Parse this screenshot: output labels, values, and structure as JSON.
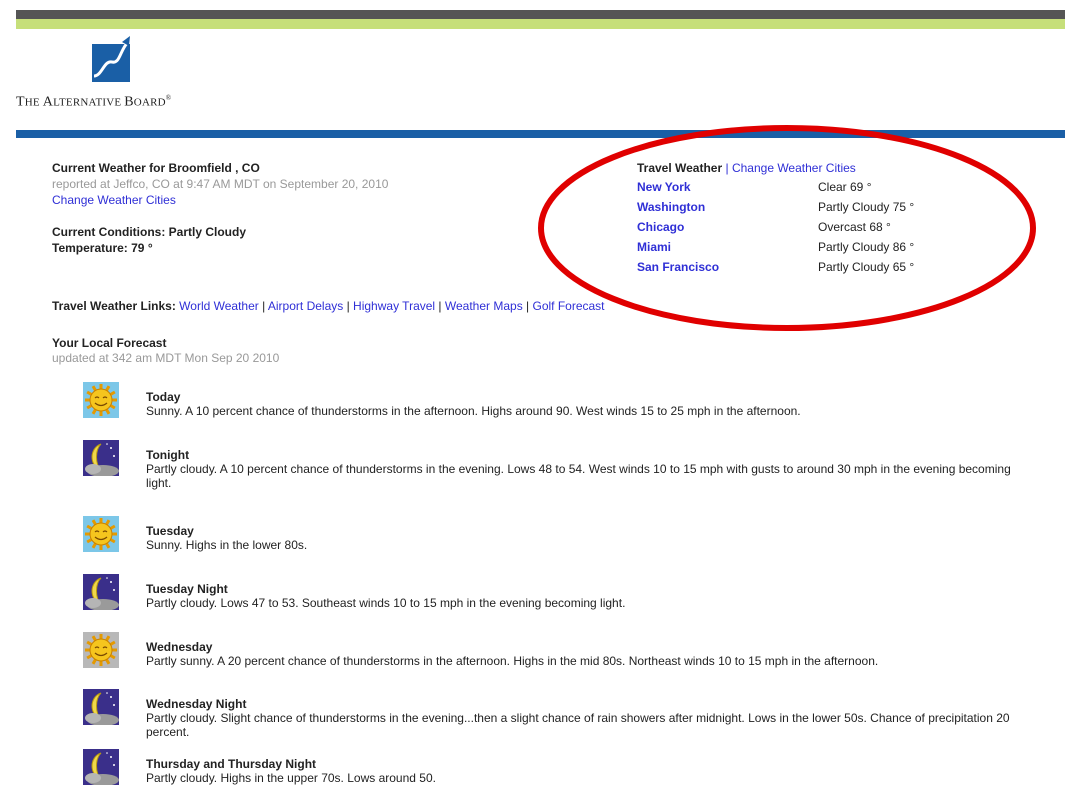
{
  "brand": {
    "name_large_1": "T",
    "name_small_1": "HE ",
    "name_large_2": "A",
    "name_small_2": "LTERNATIVE ",
    "name_large_3": "B",
    "name_small_3": "OARD",
    "mark": "®"
  },
  "current": {
    "title": "Current Weather for Broomfield , CO",
    "reported": "reported at Jeffco, CO at 9:47 AM MDT on September 20, 2010",
    "change_link": "Change Weather Cities",
    "conditions": "Current Conditions: Partly Cloudy",
    "temperature": "Temperature: 79 °"
  },
  "travel": {
    "title": "Travel Weather",
    "separator": " | ",
    "change_link": "Change Weather Cities",
    "cities": [
      {
        "city": "New York",
        "conditions": "Clear  69 °"
      },
      {
        "city": "Washington",
        "conditions": "Partly Cloudy  75 °"
      },
      {
        "city": "Chicago",
        "conditions": "Overcast  68 °"
      },
      {
        "city": "Miami",
        "conditions": "Partly Cloudy  86 °"
      },
      {
        "city": "San Francisco",
        "conditions": "Partly Cloudy  65 °"
      }
    ]
  },
  "links": {
    "label": "Travel Weather Links: ",
    "items": [
      "World Weather",
      "Airport Delays",
      "Highway Travel",
      "Weather Maps",
      "Golf Forecast"
    ],
    "sep": " | "
  },
  "local": {
    "title": "Your Local Forecast",
    "updated": "updated at 342 am MDT Mon Sep 20 2010"
  },
  "forecast": [
    {
      "period": "Today",
      "icon": "sun-icon",
      "text": "Sunny. A 10 percent chance of thunderstorms in the afternoon. Highs around 90. West winds 15 to 25 mph in the afternoon."
    },
    {
      "period": "Tonight",
      "icon": "moon-cloud-icon",
      "text": "Partly cloudy. A 10 percent chance of thunderstorms in the evening. Lows 48 to 54. West winds 10 to 15 mph with gusts to around 30 mph in the evening becoming light."
    },
    {
      "period": "Tuesday",
      "icon": "sun-icon",
      "text": "Sunny. Highs in the lower 80s."
    },
    {
      "period": "Tuesday Night",
      "icon": "moon-cloud-icon",
      "text": "Partly cloudy. Lows 47 to 53. Southeast winds 10 to 15 mph in the evening becoming light."
    },
    {
      "period": "Wednesday",
      "icon": "partly-sunny-icon",
      "text": "Partly sunny. A 20 percent chance of thunderstorms in the afternoon. Highs in the mid 80s. Northeast winds 10 to 15 mph in the afternoon."
    },
    {
      "period": "Wednesday Night",
      "icon": "moon-cloud-icon",
      "text": "Partly cloudy. Slight chance of thunderstorms in the evening...then a slight chance of rain showers after midnight. Lows in the lower 50s. Chance of precipitation 20 percent."
    },
    {
      "period": "Thursday and Thursday Night",
      "icon": "moon-cloud-icon",
      "text": "Partly cloudy. Highs in the upper 70s. Lows around 50."
    }
  ],
  "colors": {
    "link": "#2f2fd6",
    "annotation": "#e00000",
    "brand_blue": "#1a5fa6",
    "brand_green": "#c6df7a"
  }
}
